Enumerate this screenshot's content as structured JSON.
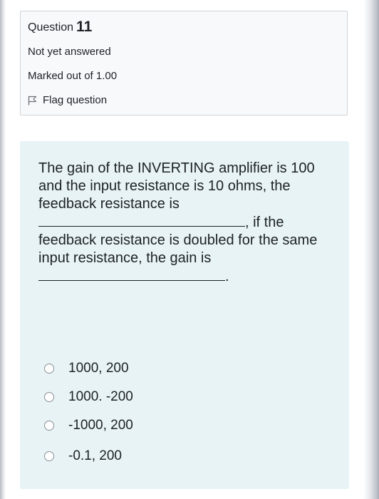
{
  "question_info": {
    "label": "Question",
    "number": "11",
    "state": "Not yet answered",
    "grade": "Marked out of 1.00",
    "flag_label": "Flag question"
  },
  "question": {
    "text_part1": "The gain of the INVERTING amplifier is 100 and the input resistance is 10 ohms, the feedback resistance is",
    "text_part2": ", if the feedback resistance is doubled for the same input resistance, the gain is",
    "text_part3": "."
  },
  "answers": [
    {
      "label": "1000, 200"
    },
    {
      "label": "1000. -200"
    },
    {
      "label": "-1000, 200"
    },
    {
      "label": "-0.1, 200"
    }
  ],
  "colors": {
    "info_bg": "#f8f9fa",
    "content_bg": "#e7f3f5",
    "text": "#1d2125"
  }
}
